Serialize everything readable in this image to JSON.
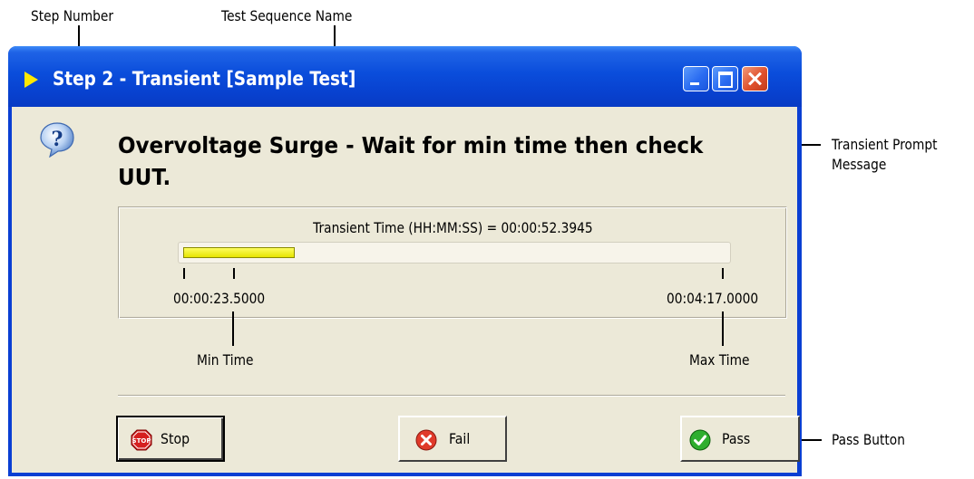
{
  "annotations": {
    "step_number": "Step Number",
    "test_sequence_name": "Test Sequence Name",
    "transient_prompt_message_line1": "Transient Prompt",
    "transient_prompt_message_line2": "Message",
    "min_time": "Min Time",
    "max_time": "Max Time",
    "pass_button": "Pass Button"
  },
  "window": {
    "title": "Step 2 - Transient [Sample Test]",
    "title_icon": "yellow-triangle-icon",
    "controls": [
      "minimize",
      "maximize",
      "close"
    ]
  },
  "prompt": {
    "icon": "question-icon",
    "message": "Overvoltage Surge - Wait for min time then check UUT."
  },
  "transient": {
    "time_label": "Transient Time (HH:MM:SS) = 00:00:52.3945",
    "progress_fraction": 0.205,
    "min_time": "00:00:23.5000",
    "max_time": "00:04:17.0000"
  },
  "buttons": {
    "stop": {
      "label": "Stop",
      "icon": "stop-sign-icon"
    },
    "fail": {
      "label": "Fail",
      "icon": "red-x-icon"
    },
    "pass": {
      "label": "Pass",
      "icon": "green-check-icon"
    }
  },
  "colors": {
    "titlebar": "#0a4ddb",
    "client_bg": "#ece9d8",
    "progress_fill": "#f0ee00"
  }
}
